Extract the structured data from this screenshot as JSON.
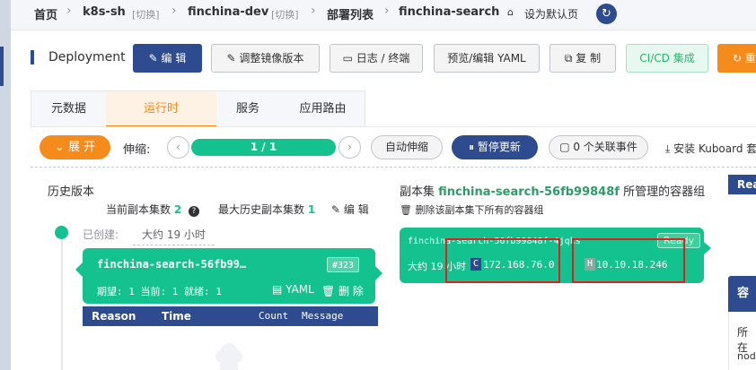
{
  "breadcrumb": {
    "home": "首页",
    "cluster": "k8s-sh",
    "cluster_switch": "[切换]",
    "namespace": "finchina-dev",
    "namespace_switch": "[切换]",
    "list": "部署列表",
    "current": "finchina-search",
    "set_default": "设为默认页"
  },
  "toolbar": {
    "kind": "Deployment",
    "edit": "编 辑",
    "adjust_image": "调整镜像版本",
    "logs": "日志 / 终端",
    "preview_yaml": "预览/编辑 YAML",
    "copy": "复 制",
    "cicd": "CI/CD 集成",
    "restart_partial": "重"
  },
  "tabs": [
    "元数据",
    "运行时",
    "服务",
    "应用路由"
  ],
  "active_tab": "运行时",
  "runtime": {
    "expand": "展 开",
    "scale_label": "伸缩:",
    "replicas": "1 / 1",
    "autoscale": "自动伸缩",
    "pause_update": "暂停更新",
    "events": "0 个关联事件",
    "install_kuboard": "安装 Kuboard 套"
  },
  "history": {
    "title": "历史版本",
    "current_replicas_label": "当前副本集数",
    "current_replicas": "2",
    "max_history_label": "最大历史副本集数",
    "max_history": "1",
    "edit": "编 辑",
    "created_label": "已创建:",
    "created_value": "大约 19 小时",
    "rs_name": "finchina-search-56fb99…",
    "rs_revision": "#323",
    "rs_status": "期望: 1 当前: 1 就绪: 1",
    "rs_yaml": "YAML",
    "rs_delete": "删 除",
    "table_headers": [
      "Reason",
      "Time",
      "Count",
      "Message"
    ]
  },
  "replicaset": {
    "prefix": "副本集",
    "name": "finchina-search-56fb99848f",
    "suffix": "所管理的容器组",
    "delete_all": "删除该副本集下所有的容器组"
  },
  "pod": {
    "name": "finchina-search-56fb99848f-4jqks",
    "status": "Ready",
    "age": "大约 19 小时",
    "container_badge": "C",
    "container_ip": "172.168.76.0",
    "host_badge": "H",
    "host_ip": "10.10.18.246"
  },
  "right_panel": {
    "top_label": "Rea",
    "section_title": "容",
    "text1": "所在",
    "text2": "node"
  },
  "colors": {
    "navy": "#2d4b8e",
    "green": "#13c28f",
    "orange": "#f58b1b",
    "highlight": "#e02020"
  }
}
